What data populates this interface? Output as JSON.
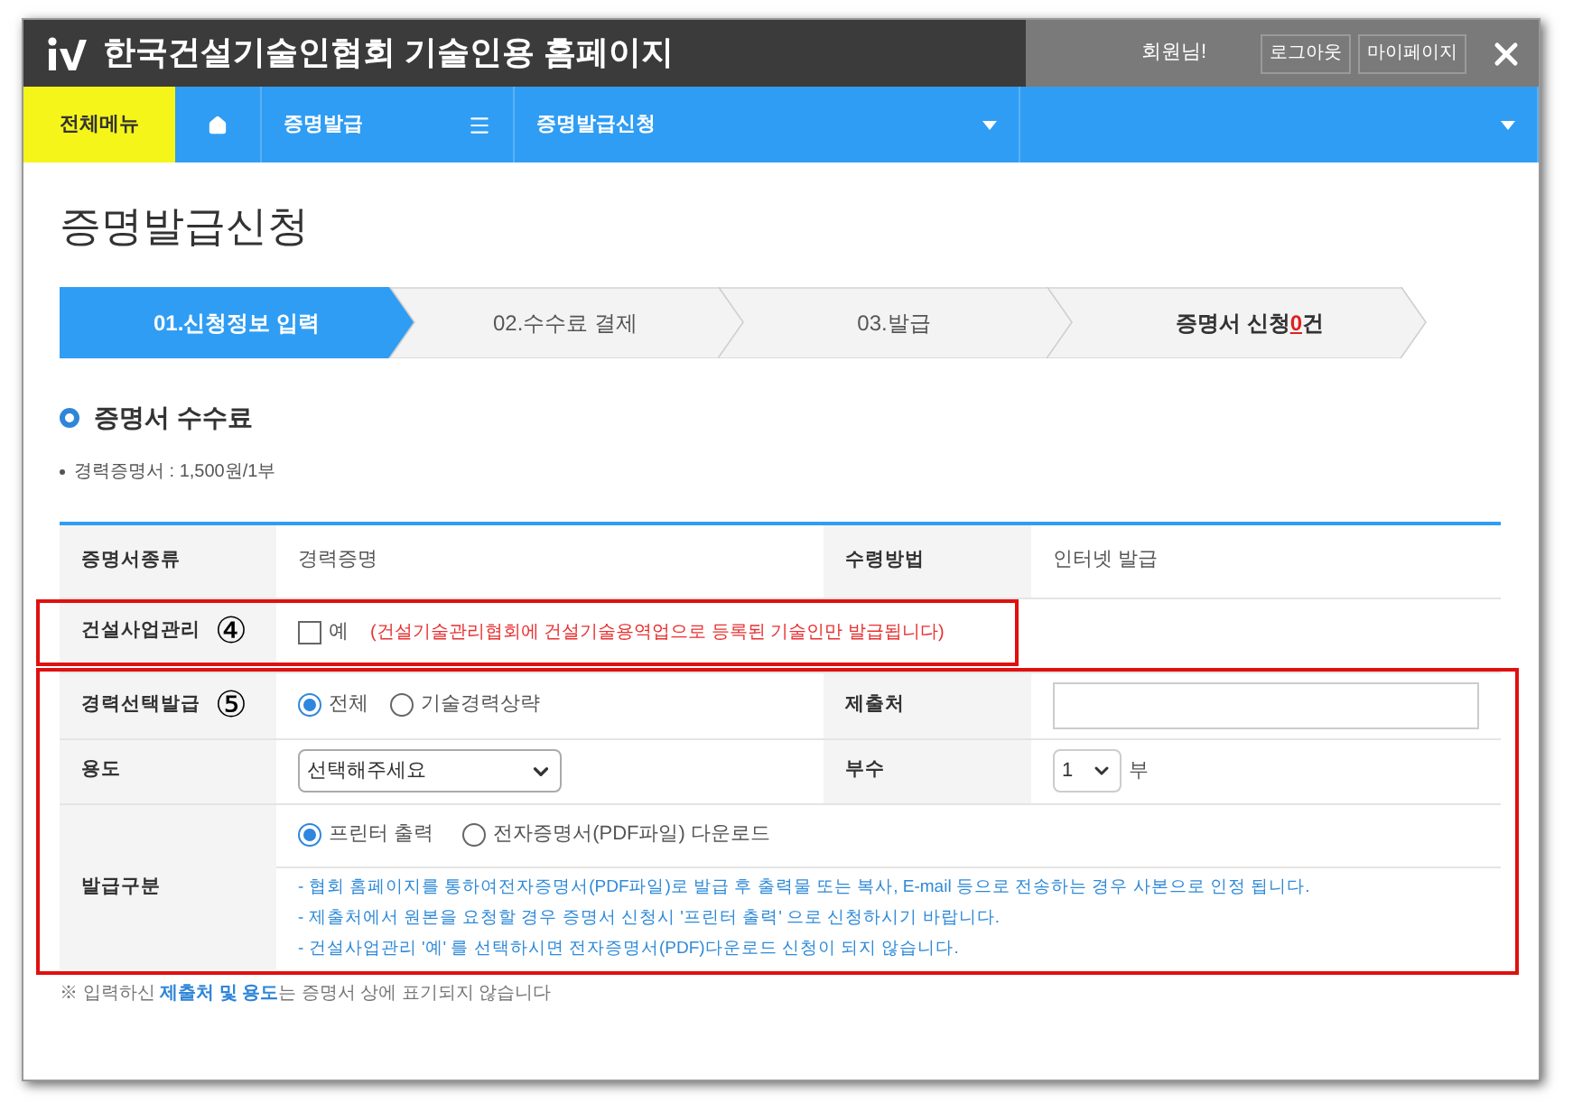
{
  "header": {
    "title": "한국건설기술인협회 기술인용 홈페이지",
    "greeting": "회원님!",
    "buttons": [
      "로그아웃",
      "마이페이지"
    ]
  },
  "nav": {
    "all_menu": "전체메뉴",
    "items": [
      {
        "label": "증명발급",
        "kind": "menu"
      },
      {
        "label": "증명발급신청",
        "kind": "dropdown"
      },
      {
        "kind": "dropdown"
      }
    ]
  },
  "page_title": "증명발급신청",
  "steps": [
    {
      "label": "01.신청정보 입력",
      "selected": true
    },
    {
      "label": "02.수수료 결제",
      "selected": false
    },
    {
      "label": "03.발급",
      "selected": false
    }
  ],
  "cart": {
    "prefix": "증명서 신청 ",
    "count": "0",
    "suffix": "건"
  },
  "fee": {
    "heading": "증명서 수수료",
    "items": [
      "경력증명서 : 1,500원/1부"
    ]
  },
  "form": {
    "certificate_type": {
      "label": "증명서종류",
      "value": "경력증명"
    },
    "receive_method": {
      "label": "수령방법",
      "value": "인터넷 발급"
    },
    "construction_mgmt": {
      "label": "건설사업관리",
      "marker": "④",
      "highlighted": true,
      "option": {
        "label": "예",
        "checked": false
      },
      "notice": "(건설기술관리협회에 건설기술용역업으로 등록된 기술인만 발급됩니다)"
    },
    "career_select": {
      "label": "경력선택발급",
      "marker": "⑤",
      "highlighted": true,
      "options": [
        {
          "label": "전체",
          "selected": true
        },
        {
          "label": "기술경력상략",
          "selected": false
        }
      ]
    },
    "submit_to": {
      "label": "제출처"
    },
    "purpose": {
      "label": "용도",
      "value": "선택해주세요"
    },
    "copies": {
      "label": "부수",
      "value": "1",
      "unit": "부"
    },
    "issue_type": {
      "label": "발급구분",
      "options": [
        {
          "label": "프린터 출력",
          "selected": true
        },
        {
          "label": "전자증명서(PDF파일) 다운로드",
          "selected": false
        }
      ],
      "notes": [
        "- 협회 홈페이지를 통하여전자증명서(PDF파일)로 발급 후 출력물 또는 복사, E-mail 등으로 전송하는 경우 사본으로 인정 됩니다.",
        "- 제출처에서 원본을 요청할 경우 증명서 신청시 '프린터 출력' 으로 신청하시기 바랍니다.",
        "- 건설사업관리 '예' 를 선택하시면 전자증명서(PDF)다운로드 신청이 되지 않습니다."
      ]
    }
  },
  "footnote": {
    "before": "※ 입력하신 ",
    "link": "제출처 및 용도",
    "after": "는 증명서 상에 표기되지 않습니다"
  }
}
